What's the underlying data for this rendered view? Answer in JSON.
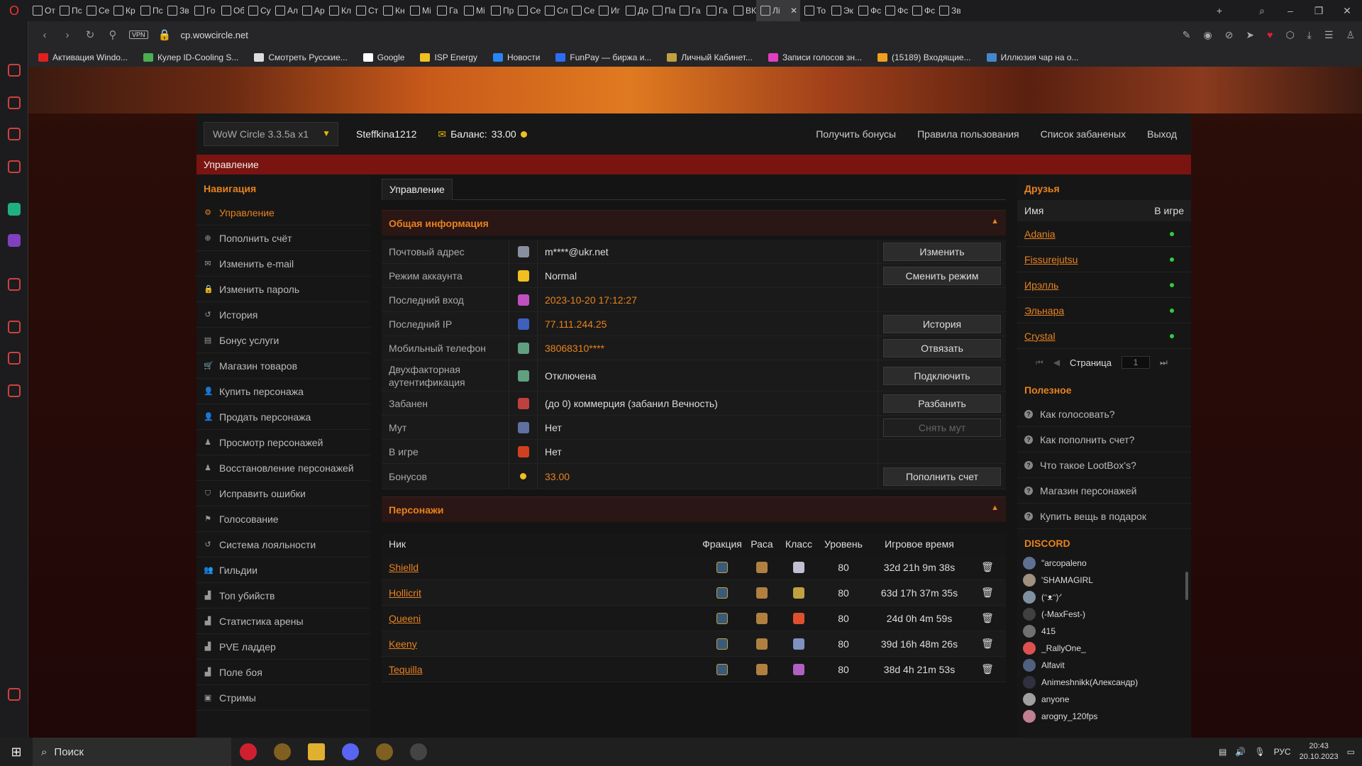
{
  "browser": {
    "tabs": [
      "От",
      "Пс",
      "Се",
      "Кр",
      "Пс",
      "Зв",
      "Го",
      "Об",
      "Су",
      "Ал",
      "Ар",
      "Кл",
      "Ст",
      "Кн",
      "Мі",
      "Га",
      "Мі",
      "Пр",
      "Се",
      "Сл",
      "Се",
      "Иг",
      "До",
      "Па",
      "Га",
      "Га",
      "ВК",
      "Лі",
      "То",
      "Эк",
      "Фс",
      "Фс",
      "Фс",
      "Зв"
    ],
    "active_tab_index": 27,
    "url": "cp.wowcircle.net",
    "vpn_label": "VPN",
    "bookmarks": [
      {
        "label": "Активация Windo...",
        "color": "#e02020"
      },
      {
        "label": "Кулер ID-Cooling S...",
        "color": "#4caf50"
      },
      {
        "label": "Смотреть Русские...",
        "color": "#dddddd"
      },
      {
        "label": "Google",
        "color": "#ffffff"
      },
      {
        "label": "ISP Energy",
        "color": "#f0c020"
      },
      {
        "label": "Новости",
        "color": "#2787f5"
      },
      {
        "label": "FunPay — биржа и...",
        "color": "#2d6df6"
      },
      {
        "label": "Личный Кабинет...",
        "color": "#c0a040"
      },
      {
        "label": "Записи голосов зн...",
        "color": "#e040c0"
      },
      {
        "label": "(15189) Входящие...",
        "color": "#f0a020"
      },
      {
        "label": "Иллюзия чар на о...",
        "color": "#4488cc"
      }
    ]
  },
  "header": {
    "realm": "WoW Circle 3.3.5a x1",
    "username": "Steffkina1212",
    "balance_label": "Баланс:",
    "balance_value": "33.00",
    "links": [
      "Получить бонусы",
      "Правила пользования",
      "Список забаненых",
      "Выход"
    ]
  },
  "breadcrumb": "Управление",
  "nav": {
    "title": "Навигация",
    "items": [
      {
        "label": "Управление",
        "icon": "gear-icon",
        "glyph": "⚙"
      },
      {
        "label": "Пополнить счёт",
        "icon": "plus-circle-icon",
        "glyph": "⊕"
      },
      {
        "label": "Изменить e-mail",
        "icon": "envelope-icon",
        "glyph": "✉"
      },
      {
        "label": "Изменить пароль",
        "icon": "lock-icon",
        "glyph": "🔒"
      },
      {
        "label": "История",
        "icon": "history-icon",
        "glyph": "↺"
      },
      {
        "label": "Бонус услуги",
        "icon": "list-icon",
        "glyph": "▤"
      },
      {
        "label": "Магазин товаров",
        "icon": "cart-icon",
        "glyph": "🛒"
      },
      {
        "label": "Купить персонажа",
        "icon": "user-icon",
        "glyph": "👤"
      },
      {
        "label": "Продать персонажа",
        "icon": "user-icon",
        "glyph": "👤"
      },
      {
        "label": "Просмотр персонажей",
        "icon": "male-icon",
        "glyph": "♟"
      },
      {
        "label": "Восстановление персонажей",
        "icon": "male-icon",
        "glyph": "♟"
      },
      {
        "label": "Исправить ошибки",
        "icon": "shield-icon",
        "glyph": "⛉"
      },
      {
        "label": "Голосование",
        "icon": "flag-icon",
        "glyph": "⚑"
      },
      {
        "label": "Система лояльности",
        "icon": "history-icon",
        "glyph": "↺"
      },
      {
        "label": "Гильдии",
        "icon": "users-icon",
        "glyph": "👥"
      },
      {
        "label": "Топ убийств",
        "icon": "chart-icon",
        "glyph": "▟"
      },
      {
        "label": "Статистика арены",
        "icon": "chart-icon",
        "glyph": "▟"
      },
      {
        "label": "PVE ладдер",
        "icon": "chart-icon",
        "glyph": "▟"
      },
      {
        "label": "Поле боя",
        "icon": "chart-icon",
        "glyph": "▟"
      },
      {
        "label": "Стримы",
        "icon": "stream-icon",
        "glyph": "▣"
      }
    ]
  },
  "main": {
    "tab": "Управление",
    "info_title": "Общая информация",
    "info_rows": [
      {
        "label": "Почтовый адрес",
        "value": "m****@ukr.net",
        "orange": false,
        "button": "Изменить",
        "icon_color": "#8890a0",
        "icon": "mail-avatar-icon"
      },
      {
        "label": "Режим аккаунта",
        "value": "Normal",
        "orange": false,
        "button": "Сменить режим",
        "icon_color": "#f0c020",
        "icon": "star-icon"
      },
      {
        "label": "Последний вход",
        "value": "2023-10-20 17:12:27",
        "orange": true,
        "button": "",
        "icon_color": "#c050c0",
        "icon": "login-icon"
      },
      {
        "label": "Последний IP",
        "value": "77.111.244.25",
        "orange": true,
        "button": "История",
        "icon_color": "#4060c0",
        "icon": "ip-icon"
      },
      {
        "label": "Мобильный телефон",
        "value": "38068310****",
        "orange": true,
        "button": "Отвязать",
        "icon_color": "#60a080",
        "icon": "phone-icon"
      },
      {
        "label": "Двухфакторная аутентификация",
        "value": "Отключена",
        "orange": false,
        "button": "Подключить",
        "icon_color": "#60a080",
        "icon": "2fa-icon"
      },
      {
        "label": "Забанен",
        "value": "(до 0) коммерция (забанил Вечность)",
        "orange": false,
        "button": "Разбанить",
        "icon_color": "#c04040",
        "icon": "ban-icon"
      },
      {
        "label": "Мут",
        "value": "Нет",
        "orange": false,
        "button": "Снять мут",
        "disabled": true,
        "icon_color": "#6070a0",
        "icon": "mute-icon"
      },
      {
        "label": "В игре",
        "value": "Нет",
        "orange": false,
        "button": "",
        "icon_color": "#d04020",
        "icon": "ingame-icon"
      },
      {
        "label": "Бонусов",
        "value": "33.00",
        "orange": true,
        "button": "Пополнить счет",
        "icon_color": "#f0c020",
        "icon": "coin-icon"
      }
    ],
    "chars_title": "Персонажи",
    "chars_headers": [
      "Ник",
      "Фракция",
      "Раса",
      "Класс",
      "Уровень",
      "Игровое время"
    ],
    "chars": [
      {
        "nick": "Shielld",
        "level": "80",
        "time": "32d 21h 9m 38s",
        "class_color": "#c0c0d0"
      },
      {
        "nick": "Hollicrit",
        "level": "80",
        "time": "63d 17h 37m 35s",
        "class_color": "#c0a040"
      },
      {
        "nick": "Queeni",
        "level": "80",
        "time": "24d 0h 4m 59s",
        "class_color": "#e05030"
      },
      {
        "nick": "Keeny",
        "level": "80",
        "time": "39d 16h 48m 26s",
        "class_color": "#8090c0"
      },
      {
        "nick": "Tequilla",
        "level": "80",
        "time": "38d 4h 21m 53s",
        "class_color": "#b060c0"
      }
    ]
  },
  "friends": {
    "title": "Друзья",
    "col_name": "Имя",
    "col_ingame": "В игре",
    "list": [
      "Adania",
      "Fissurejutsu",
      "Ирэлль",
      "Эльнара",
      "Crystal"
    ],
    "page_label": "Страница",
    "page_value": "1"
  },
  "useful": {
    "title": "Полезное",
    "items": [
      "Как голосовать?",
      "Как пополнить счет?",
      "Что такое LootBox's?",
      "Магазин персонажей",
      "Купить вещь в подарок"
    ]
  },
  "discord": {
    "title": "DISCORD",
    "members": [
      "\"arcopaleno",
      "'SHAMAGIRL",
      "(ᵔᴥᵔ)ᐟ",
      "(-MaxFest-)",
      "415",
      "_RallyOne_",
      "Alfavit",
      "Animeshnikk(Александр)",
      "anyone",
      "arogny_120fps"
    ]
  },
  "taskbar": {
    "search": "Поиск",
    "lang": "РУС",
    "time": "20:43",
    "date": "20.10.2023"
  },
  "colors": {
    "accent": "#e8821e",
    "crumb": "#7a1410",
    "online": "#2ecc40"
  }
}
